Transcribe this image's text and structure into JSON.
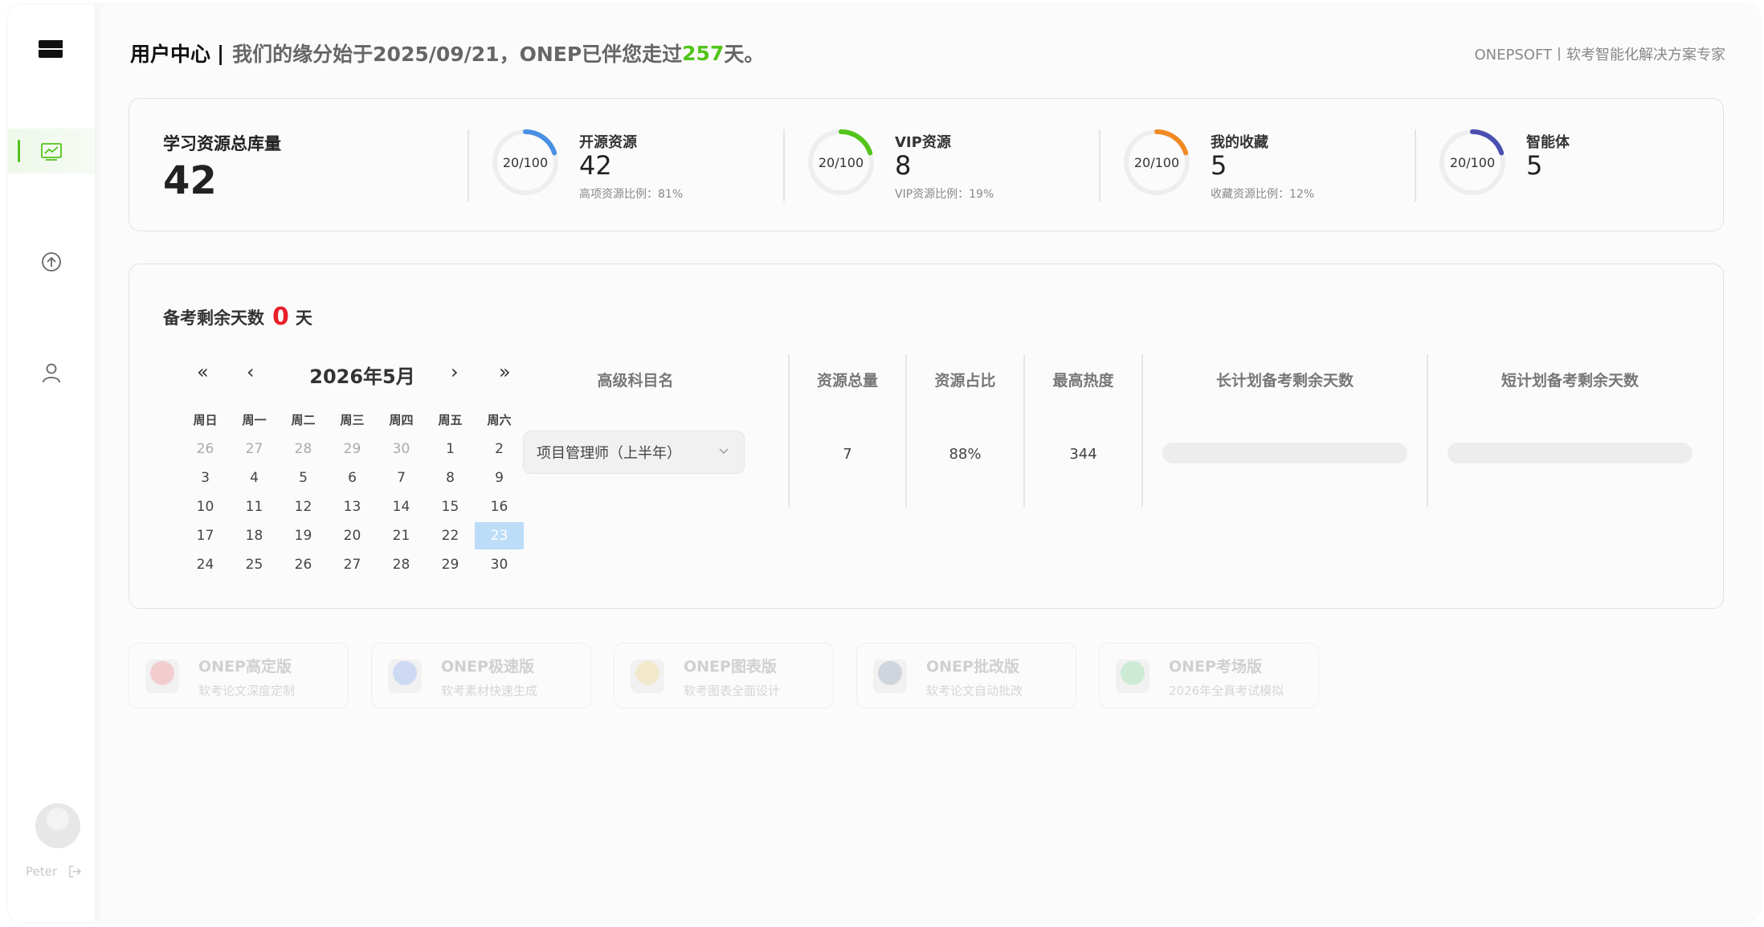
{
  "header": {
    "title": "用户中心",
    "separator": "|",
    "subtitle_prefix": "我们的缘分始于2025/09/21，ONEP已伴您走过",
    "days": "257",
    "subtitle_suffix": "天。",
    "brand": "ONEPSOFT丨软考智能化解决方案专家"
  },
  "sidebar": {
    "items": [
      {
        "icon": "chart-line-icon",
        "active": true
      },
      {
        "icon": "arrow-up-circle-icon",
        "active": false
      },
      {
        "icon": "user-icon",
        "active": false
      }
    ],
    "user_name": "Peter"
  },
  "stats": {
    "total_label": "学习资源总库量",
    "total_value": "42",
    "items": [
      {
        "ring_text": "20/100",
        "ring_value": 0.2,
        "ring_color": "#4a90e2",
        "title": "开源资源",
        "value": "42",
        "sub": "高项资源比例：81%"
      },
      {
        "ring_text": "20/100",
        "ring_value": 0.2,
        "ring_color": "#52c41a",
        "title": "VIP资源",
        "value": "8",
        "sub": "VIP资源比例：19%"
      },
      {
        "ring_text": "20/100",
        "ring_value": 0.2,
        "ring_color": "#f08a24",
        "title": "我的收藏",
        "value": "5",
        "sub": "收藏资源比例：12%"
      },
      {
        "ring_text": "20/100",
        "ring_value": 0.2,
        "ring_color": "#4a4fb0",
        "title": "智能体",
        "value": "5",
        "sub": ""
      }
    ]
  },
  "plan": {
    "title_prefix": "备考剩余天数",
    "days": "0",
    "title_suffix": "天",
    "calendar": {
      "first": "«",
      "prev": "‹",
      "next": "›",
      "last": "»",
      "month": "2026年5月",
      "weekdays": [
        "周日",
        "周一",
        "周二",
        "周三",
        "周四",
        "周五",
        "周六"
      ],
      "weeks": [
        [
          {
            "d": "26",
            "o": true
          },
          {
            "d": "27",
            "o": true
          },
          {
            "d": "28",
            "o": true
          },
          {
            "d": "29",
            "o": true
          },
          {
            "d": "30",
            "o": true
          },
          {
            "d": "1"
          },
          {
            "d": "2"
          }
        ],
        [
          {
            "d": "3"
          },
          {
            "d": "4"
          },
          {
            "d": "5"
          },
          {
            "d": "6"
          },
          {
            "d": "7"
          },
          {
            "d": "8"
          },
          {
            "d": "9"
          }
        ],
        [
          {
            "d": "10"
          },
          {
            "d": "11"
          },
          {
            "d": "12"
          },
          {
            "d": "13"
          },
          {
            "d": "14"
          },
          {
            "d": "15"
          },
          {
            "d": "16"
          }
        ],
        [
          {
            "d": "17"
          },
          {
            "d": "18"
          },
          {
            "d": "19"
          },
          {
            "d": "20"
          },
          {
            "d": "21"
          },
          {
            "d": "22"
          },
          {
            "d": "23",
            "t": true
          }
        ],
        [
          {
            "d": "24"
          },
          {
            "d": "25"
          },
          {
            "d": "26"
          },
          {
            "d": "27"
          },
          {
            "d": "28"
          },
          {
            "d": "29"
          },
          {
            "d": "30"
          }
        ]
      ]
    },
    "table": {
      "headers": [
        "高级科目名",
        "资源总量",
        "资源占比",
        "最高热度",
        "长计划备考剩余天数",
        "短计划备考剩余天数"
      ],
      "subject_select": "项目管理师（上半年）",
      "total": "7",
      "ratio": "88%",
      "heat": "344",
      "long_plan_progress": 0,
      "short_plan_progress": 0
    }
  },
  "products": [
    {
      "name": "ONEP高定版",
      "desc": "软考论文深度定制",
      "color": "#e89aa0"
    },
    {
      "name": "ONEP极速版",
      "desc": "软考素材快速生成",
      "color": "#9ab4e8"
    },
    {
      "name": "ONEP图表版",
      "desc": "软考图表全面设计",
      "color": "#e8d49a"
    },
    {
      "name": "ONEP批改版",
      "desc": "软考论文自动批改",
      "color": "#a0a8b8"
    },
    {
      "name": "ONEP考场版",
      "desc": "2026年全真考试模拟",
      "color": "#9ad8a8"
    }
  ]
}
